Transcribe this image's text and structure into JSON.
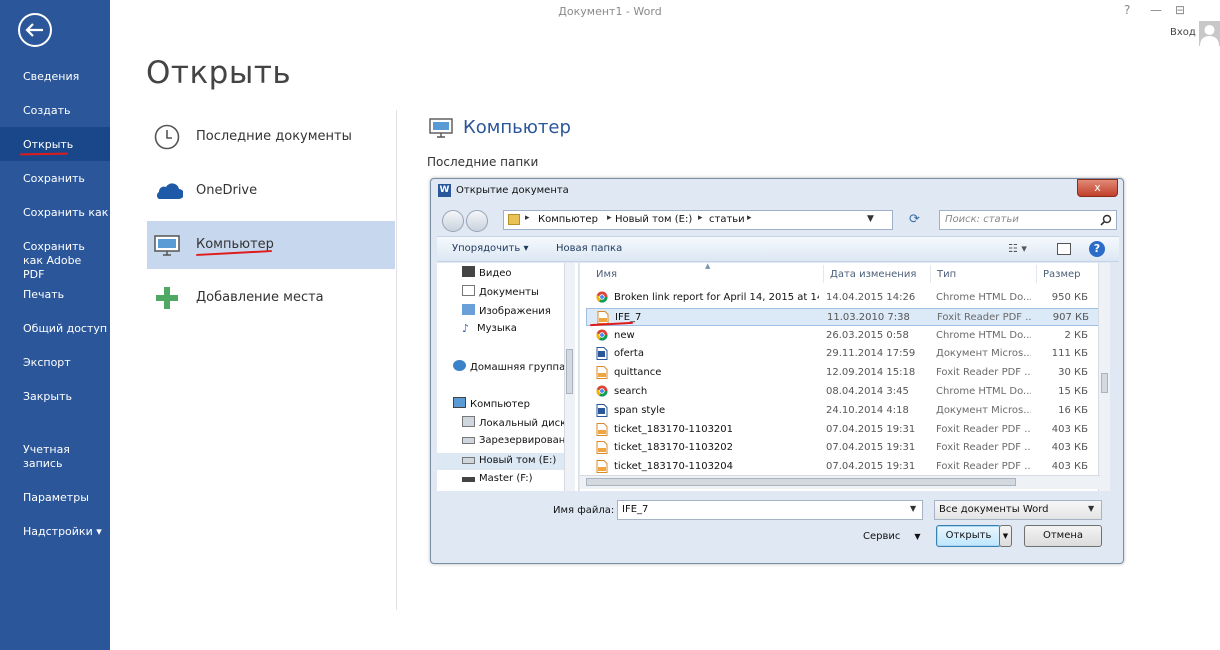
{
  "window": {
    "title": "Документ1 - Word",
    "help": "?",
    "restore": "⊟",
    "minimize": "—",
    "sign_in": "Вход"
  },
  "sidebar": {
    "items": [
      {
        "label": "Сведения"
      },
      {
        "label": "Создать"
      },
      {
        "label": "Открыть"
      },
      {
        "label": "Сохранить"
      },
      {
        "label": "Сохранить как"
      },
      {
        "label": "Сохранить как Adobe PDF"
      },
      {
        "label": "Печать"
      },
      {
        "label": "Общий доступ"
      },
      {
        "label": "Экспорт"
      },
      {
        "label": "Закрыть"
      },
      {
        "label": "Учетная запись"
      },
      {
        "label": "Параметры"
      },
      {
        "label": "Надстройки ▾"
      }
    ]
  },
  "page": {
    "title": "Открыть"
  },
  "places": [
    {
      "label": "Последние документы",
      "icon": "clock-icon"
    },
    {
      "label": "OneDrive",
      "icon": "cloud-icon"
    },
    {
      "label": "Компьютер",
      "icon": "computer-icon"
    },
    {
      "label": "Добавление места",
      "icon": "plus-icon"
    }
  ],
  "computer_panel": {
    "heading": "Компьютер",
    "recent_folders_label": "Последние папки"
  },
  "dialog": {
    "title": "Открытие документа",
    "close": "x",
    "breadcrumb": [
      "Компьютер",
      "Новый том (E:)",
      "статьи"
    ],
    "search_placeholder": "Поиск: статьи",
    "toolbar": {
      "organize": "Упорядочить ▾",
      "new_folder": "Новая папка"
    },
    "nav": [
      {
        "label": "Видео"
      },
      {
        "label": "Документы"
      },
      {
        "label": "Изображения"
      },
      {
        "label": "Музыка"
      },
      {
        "label": "Домашняя группа"
      },
      {
        "label": "Компьютер"
      },
      {
        "label": "Локальный диск"
      },
      {
        "label": "Зарезервирован"
      },
      {
        "label": "Новый том (E:)"
      },
      {
        "label": "Master (F:)"
      }
    ],
    "columns": {
      "name": "Имя",
      "modified": "Дата изменения",
      "type": "Тип",
      "size": "Размер"
    },
    "files": [
      {
        "name": "Broken link report for April 14, 2015 at 14 ...",
        "date": "14.04.2015 14:26",
        "type": "Chrome HTML Do...",
        "size": "950 КБ",
        "icon": "chrome-icon"
      },
      {
        "name": "IFE_7",
        "date": "11.03.2010 7:38",
        "type": "Foxit Reader PDF ...",
        "size": "907 КБ",
        "icon": "pdf-icon"
      },
      {
        "name": "new",
        "date": "26.03.2015 0:58",
        "type": "Chrome HTML Do...",
        "size": "2 КБ",
        "icon": "chrome-icon"
      },
      {
        "name": "oferta",
        "date": "29.11.2014 17:59",
        "type": "Документ Micros...",
        "size": "111 КБ",
        "icon": "word-icon"
      },
      {
        "name": "quittance",
        "date": "12.09.2014 15:18",
        "type": "Foxit Reader PDF ...",
        "size": "30 КБ",
        "icon": "pdf-icon"
      },
      {
        "name": "search",
        "date": "08.04.2014 3:45",
        "type": "Chrome HTML Do...",
        "size": "15 КБ",
        "icon": "chrome-icon"
      },
      {
        "name": "span style",
        "date": "24.10.2014 4:18",
        "type": "Документ Micros...",
        "size": "16 КБ",
        "icon": "word-icon"
      },
      {
        "name": "ticket_183170-1103201",
        "date": "07.04.2015 19:31",
        "type": "Foxit Reader PDF ...",
        "size": "403 КБ",
        "icon": "pdf-icon"
      },
      {
        "name": "ticket_183170-1103202",
        "date": "07.04.2015 19:31",
        "type": "Foxit Reader PDF ...",
        "size": "403 КБ",
        "icon": "pdf-icon"
      },
      {
        "name": "ticket_183170-1103204",
        "date": "07.04.2015 19:31",
        "type": "Foxit Reader PDF ...",
        "size": "403 КБ",
        "icon": "pdf-icon"
      }
    ],
    "filename_label": "Имя файла:",
    "filename_value": "IFE_7",
    "filetype": "Все документы Word",
    "tools": "Сервис",
    "open_btn": "Открыть",
    "cancel_btn": "Отмена"
  },
  "colors": {
    "accent": "#2b579a",
    "annotation": "#e01b1b"
  }
}
